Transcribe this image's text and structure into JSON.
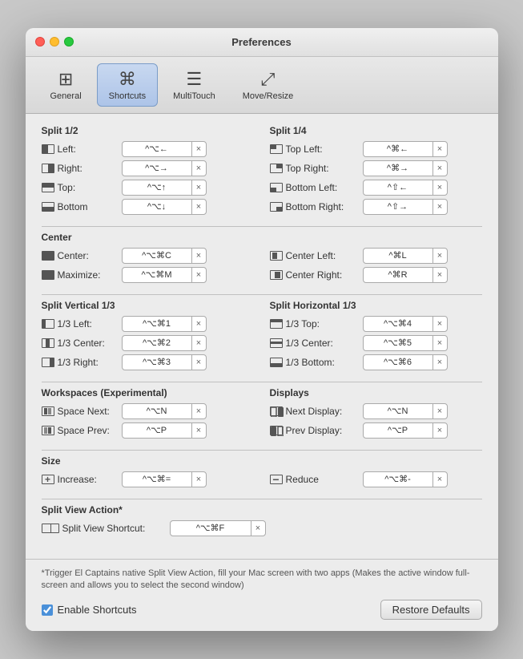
{
  "window": {
    "title": "Preferences"
  },
  "toolbar": {
    "items": [
      {
        "id": "general",
        "label": "General",
        "icon": "⊞"
      },
      {
        "id": "shortcuts",
        "label": "Shortcuts",
        "icon": "⌘"
      },
      {
        "id": "multitouch",
        "label": "MultiTouch",
        "icon": "☰"
      },
      {
        "id": "move_resize",
        "label": "Move/Resize",
        "icon": "⤢"
      }
    ],
    "active": "shortcuts"
  },
  "sections": {
    "split_half": {
      "title": "Split 1/2",
      "shortcuts": [
        {
          "id": "left",
          "label": "Left:",
          "value": "^⌥←",
          "icon": "left"
        },
        {
          "id": "right",
          "label": "Right:",
          "value": "^⌥→",
          "icon": "right"
        },
        {
          "id": "top",
          "label": "Top:",
          "value": "^⌥↑",
          "icon": "top"
        },
        {
          "id": "bottom",
          "label": "Bottom",
          "value": "^⌥↓",
          "icon": "bottom"
        }
      ]
    },
    "split_quarter": {
      "title": "Split 1/4",
      "shortcuts": [
        {
          "id": "top_left",
          "label": "Top Left:",
          "value": "^⌘←",
          "icon": "top-left"
        },
        {
          "id": "top_right",
          "label": "Top Right:",
          "value": "^⌘→",
          "icon": "top-right"
        },
        {
          "id": "bottom_left",
          "label": "Bottom Left:",
          "value": "^⇧←",
          "icon": "bottom-left"
        },
        {
          "id": "bottom_right",
          "label": "Bottom Right:",
          "value": "^⇧→",
          "icon": "bottom-right"
        }
      ]
    },
    "center": {
      "title": "Center",
      "shortcuts": [
        {
          "id": "center",
          "label": "Center:",
          "value": "^⌥⌘C",
          "icon": "center-full"
        },
        {
          "id": "maximize",
          "label": "Maximize:",
          "value": "^⌥⌘M",
          "icon": "maximize"
        }
      ]
    },
    "center_sides": {
      "shortcuts": [
        {
          "id": "center_left",
          "label": "Center Left:",
          "value": "^⌘L",
          "icon": "center-left"
        },
        {
          "id": "center_right",
          "label": "Center Right:",
          "value": "^⌘R",
          "icon": "center-right"
        }
      ]
    },
    "split_vertical": {
      "title": "Split Vertical 1/3",
      "shortcuts": [
        {
          "id": "third_left",
          "label": "1/3 Left:",
          "value": "^⌥⌘1",
          "icon": "third-left"
        },
        {
          "id": "third_center",
          "label": "1/3 Center:",
          "value": "^⌥⌘2",
          "icon": "third-center"
        },
        {
          "id": "third_right",
          "label": "1/3 Right:",
          "value": "^⌥⌘3",
          "icon": "third-right"
        }
      ]
    },
    "split_horizontal": {
      "title": "Split Horizontal 1/3",
      "shortcuts": [
        {
          "id": "h_third_top",
          "label": "1/3 Top:",
          "value": "^⌥⌘4",
          "icon": "h-third-top"
        },
        {
          "id": "h_third_center",
          "label": "1/3 Center:",
          "value": "^⌥⌘5",
          "icon": "h-third-center"
        },
        {
          "id": "h_third_bottom",
          "label": "1/3 Bottom:",
          "value": "^⌥⌘6",
          "icon": "h-third-bottom"
        }
      ]
    },
    "workspaces": {
      "title": "Workspaces (Experimental)",
      "shortcuts": [
        {
          "id": "space_next",
          "label": "Space Next:",
          "value": "^⌥N",
          "icon": "space"
        },
        {
          "id": "space_prev",
          "label": "Space Prev:",
          "value": "^⌥P",
          "icon": "space"
        }
      ]
    },
    "displays": {
      "title": "Displays",
      "shortcuts": [
        {
          "id": "next_display",
          "label": "Next Display:",
          "value": "^⌥N",
          "icon": "next-display"
        },
        {
          "id": "prev_display",
          "label": "Prev Display:",
          "value": "^⌥P",
          "icon": "prev-display"
        }
      ]
    },
    "size": {
      "title": "Size",
      "shortcuts": [
        {
          "id": "increase",
          "label": "Increase:",
          "value": "^⌥⌘=",
          "icon": "increase"
        },
        {
          "id": "reduce",
          "label": "Reduce",
          "value": "^⌥⌘-",
          "icon": "reduce"
        }
      ]
    },
    "split_view": {
      "title": "Split View Action*",
      "shortcuts": [
        {
          "id": "split_view",
          "label": "Split View Shortcut:",
          "value": "^⌥⌘F",
          "icon": "split-view"
        }
      ]
    }
  },
  "footer": {
    "note": "*Trigger El Captains native Split View Action, fill your Mac screen with two apps (Makes the active window full-screen and allows you to select the second window)",
    "enable_label": "Enable Shortcuts",
    "restore_label": "Restore Defaults",
    "enable_checked": true
  }
}
